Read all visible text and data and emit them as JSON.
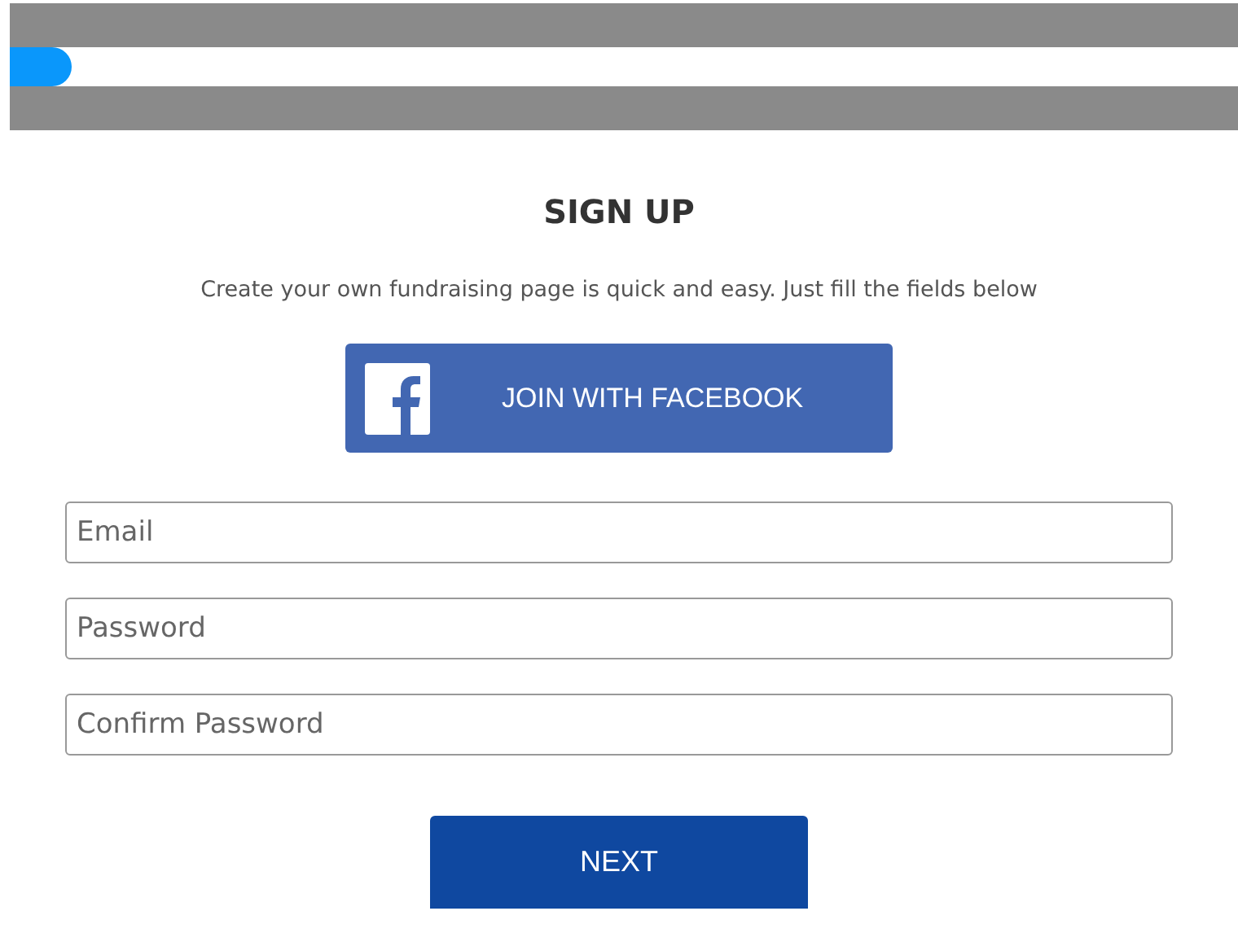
{
  "progress": {
    "level": 0.05
  },
  "heading": "SIGN UP",
  "subtitle": "Create your own fundraising page is quick and easy. Just fill the fields below",
  "facebook_button": {
    "label": "JOIN WITH FACEBOOK"
  },
  "fields": [
    {
      "placeholder": "Email"
    },
    {
      "placeholder": "Password"
    },
    {
      "placeholder": "Confirm Password"
    }
  ],
  "next_button": {
    "label": "NEXT"
  }
}
